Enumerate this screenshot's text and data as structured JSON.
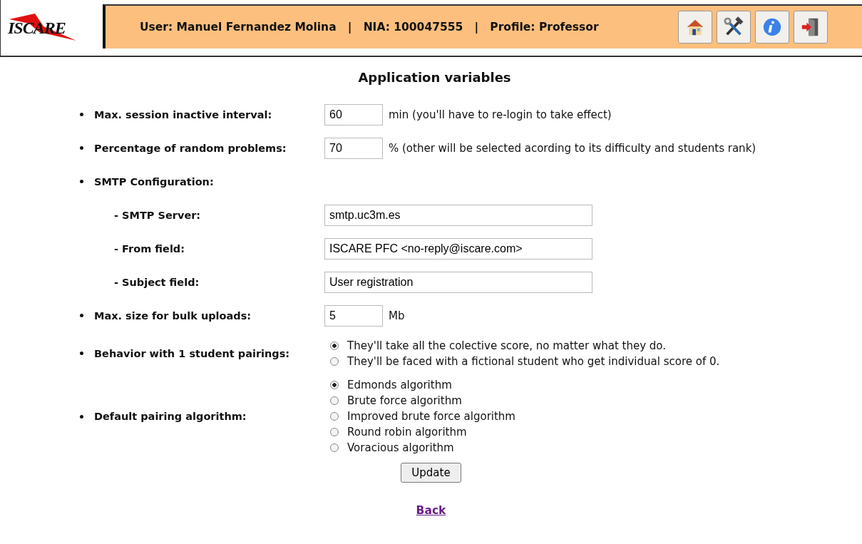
{
  "header": {
    "logo": "ISCARE",
    "user_info": "User: Manuel Fernandez Molina   |   NIA: 100047555   |   Profile: Professor",
    "toolbar": [
      {
        "kind": "home"
      },
      {
        "kind": "tools"
      },
      {
        "kind": "info"
      },
      {
        "kind": "exit"
      }
    ]
  },
  "title": "Application variables",
  "settings": [
    {
      "kind": "short_input",
      "label": "Max. session inactive interval:",
      "value": "60",
      "note": "min (you'll have to re-login to take effect)"
    },
    {
      "kind": "short_input",
      "label": "Percentage of random problems:",
      "value": "70",
      "note": "% (other will be selected acording to its difficulty and students rank)"
    },
    {
      "kind": "section",
      "label": "SMTP Configuration:",
      "children": [
        {
          "label": "- SMTP Server:",
          "value": "smtp.uc3m.es"
        },
        {
          "label": "- From field:",
          "value": "ISCARE PFC <no-reply@iscare.com>"
        },
        {
          "label": "- Subject field:",
          "value": "User registration"
        }
      ]
    },
    {
      "kind": "short_input",
      "label": "Max. size for bulk uploads:",
      "value": "5",
      "note": "Mb"
    },
    {
      "kind": "radio_group",
      "label": "Behavior with 1 student pairings:",
      "options": [
        {
          "label": "They'll take all the colective score, no matter what they do.",
          "selected": true
        },
        {
          "label": "They'll be faced with a fictional student who get individual score of 0.",
          "selected": false
        }
      ]
    },
    {
      "kind": "radio_group",
      "label": "Default pairing algorithm:",
      "options": [
        {
          "label": "Edmonds algorithm",
          "selected": true
        },
        {
          "label": "Brute force algorithm",
          "selected": false
        },
        {
          "label": "Improved brute force algorithm",
          "selected": false
        },
        {
          "label": "Round robin algorithm",
          "selected": false
        },
        {
          "label": "Voracious algorithm",
          "selected": false
        }
      ]
    }
  ],
  "update_button": "Update",
  "back_link": "Back"
}
